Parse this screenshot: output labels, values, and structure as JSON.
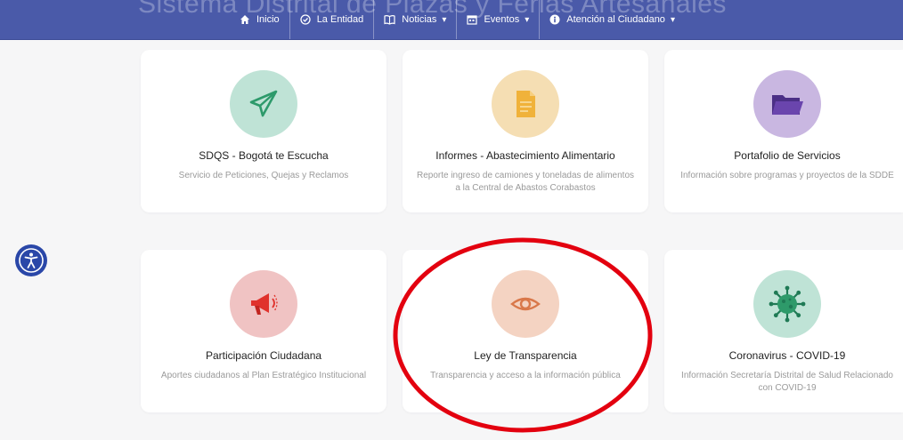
{
  "background_title": "Sistema Distrital de Plazas y Ferias Artesanales",
  "nav": {
    "items": [
      {
        "label": "Inicio",
        "icon": "home-icon",
        "dropdown": false
      },
      {
        "label": "La Entidad",
        "icon": "check-circle-icon",
        "dropdown": false
      },
      {
        "label": "Noticias",
        "icon": "book-icon",
        "dropdown": true
      },
      {
        "label": "Eventos",
        "icon": "calendar-icon",
        "dropdown": true
      },
      {
        "label": "Atención al Ciudadano",
        "icon": "info-circle-icon",
        "dropdown": true
      }
    ],
    "caret": "▾"
  },
  "cards": [
    {
      "title": "SDQS - Bogotá te Escucha",
      "desc": "Servicio de Peticiones, Quejas y Reclamos",
      "icon": "paper-plane-icon",
      "color": "#bfe3d6"
    },
    {
      "title": "Informes - Abastecimiento Alimentario",
      "desc": "Reporte ingreso de camiones y toneladas de alimentos a la Central de Abastos Corabastos",
      "icon": "document-icon",
      "color": "#f5deb3"
    },
    {
      "title": "Portafolio de Servicios",
      "desc": "Información sobre programas y proyectos de la SDDE",
      "icon": "folder-icon",
      "color": "#c9b7e1"
    },
    {
      "title": "Participación Ciudadana",
      "desc": "Aportes ciudadanos al Plan Estratégico Institucional",
      "icon": "megaphone-icon",
      "color": "#f0c3c3"
    },
    {
      "title": "Ley de Transparencia",
      "desc": "Transparencia y acceso a la información pública",
      "icon": "eye-icon",
      "color": "#f4d3c2"
    },
    {
      "title": "Coronavirus - COVID-19",
      "desc": "Información Secretaría Distrital de Salud Relacionado con COVID-19",
      "icon": "virus-icon",
      "color": "#bfe3d6"
    }
  ],
  "accessibility": {
    "icon": "accessibility-icon",
    "color": "#2a47a8"
  },
  "annotation": {
    "shape": "ellipse",
    "color": "#e3000f",
    "target": "Ley de Transparencia"
  }
}
